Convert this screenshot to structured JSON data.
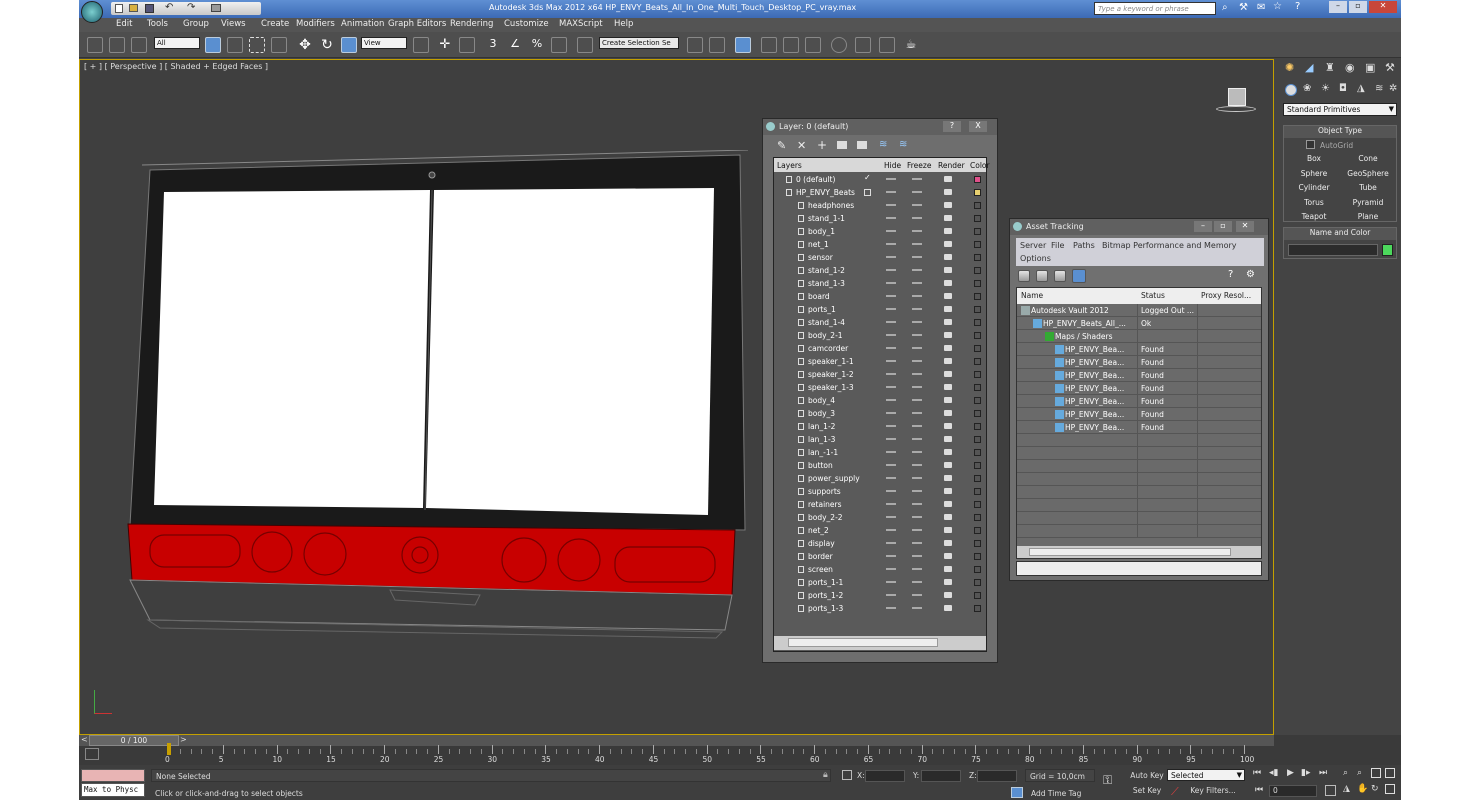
{
  "window": {
    "title": "Autodesk 3ds Max 2012 x64      HP_ENVY_Beats_All_In_One_Multi_Touch_Desktop_PC_vray.max",
    "search_placeholder": "Type a keyword or phrase"
  },
  "menu": [
    "Edit",
    "Tools",
    "Group",
    "Views",
    "Create",
    "Modifiers",
    "Animation",
    "Graph Editors",
    "Rendering",
    "Customize",
    "MAXScript",
    "Help"
  ],
  "toolbar": {
    "filter": "All",
    "view": "View",
    "selection_set": "Create Selection Se"
  },
  "viewport": {
    "label": "[ + ] [ Perspective ] [ Shaded + Edged Faces ]"
  },
  "layer_dialog": {
    "title": "Layer: 0 (default)",
    "help": "?",
    "close": "X",
    "columns": [
      "Layers",
      "Hide",
      "Freeze",
      "Render",
      "Color"
    ],
    "rows": [
      {
        "name": "0 (default)",
        "color": "#e0508a",
        "indent": 0,
        "active": true
      },
      {
        "name": "HP_ENVY_Beats",
        "color": "#e8d070",
        "indent": 0,
        "active": false
      },
      {
        "name": "headphones"
      },
      {
        "name": "stand_1-1"
      },
      {
        "name": "body_1"
      },
      {
        "name": "net_1"
      },
      {
        "name": "sensor"
      },
      {
        "name": "stand_1-2"
      },
      {
        "name": "stand_1-3"
      },
      {
        "name": "board"
      },
      {
        "name": "ports_1"
      },
      {
        "name": "stand_1-4"
      },
      {
        "name": "body_2-1"
      },
      {
        "name": "camcorder"
      },
      {
        "name": "speaker_1-1"
      },
      {
        "name": "speaker_1-2"
      },
      {
        "name": "speaker_1-3"
      },
      {
        "name": "body_4"
      },
      {
        "name": "body_3"
      },
      {
        "name": "lan_1-2"
      },
      {
        "name": "lan_1-3"
      },
      {
        "name": "lan_-1-1"
      },
      {
        "name": "button"
      },
      {
        "name": "power_supply"
      },
      {
        "name": "supports"
      },
      {
        "name": "retainers"
      },
      {
        "name": "body_2-2"
      },
      {
        "name": "net_2"
      },
      {
        "name": "display"
      },
      {
        "name": "border"
      },
      {
        "name": "screen"
      },
      {
        "name": "ports_1-1"
      },
      {
        "name": "ports_1-2"
      },
      {
        "name": "ports_1-3"
      }
    ]
  },
  "asset_tracking": {
    "title": "Asset Tracking",
    "menu": [
      "Server",
      "File",
      "Paths",
      "Bitmap Performance and Memory",
      "Options"
    ],
    "columns": [
      "Name",
      "Status",
      "Proxy Resol..."
    ],
    "rows": [
      {
        "name": "Autodesk Vault 2012",
        "status": "Logged Out ..."
      },
      {
        "name": "HP_ENVY_Beats_All_...",
        "status": "Ok"
      },
      {
        "name": "Maps / Shaders",
        "status": ""
      },
      {
        "name": "HP_ENVY_Bea...",
        "status": "Found"
      },
      {
        "name": "HP_ENVY_Bea...",
        "status": "Found"
      },
      {
        "name": "HP_ENVY_Bea...",
        "status": "Found"
      },
      {
        "name": "HP_ENVY_Bea...",
        "status": "Found"
      },
      {
        "name": "HP_ENVY_Bea...",
        "status": "Found"
      },
      {
        "name": "HP_ENVY_Bea...",
        "status": "Found"
      },
      {
        "name": "HP_ENVY_Bea...",
        "status": "Found"
      }
    ]
  },
  "command_panel": {
    "dropdown": "Standard Primitives",
    "object_type": "Object Type",
    "autogrid": "AutoGrid",
    "buttons": [
      "Box",
      "Cone",
      "Sphere",
      "GeoSphere",
      "Cylinder",
      "Tube",
      "Torus",
      "Pyramid",
      "Teapot",
      "Plane"
    ],
    "name_and_color": "Name and Color",
    "swatch_color": "#4cd85c"
  },
  "timeline": {
    "frame": "0 / 100",
    "ticks": [
      0,
      5,
      10,
      15,
      20,
      25,
      30,
      35,
      40,
      45,
      50,
      55,
      60,
      65,
      70,
      75,
      80,
      85,
      90,
      95,
      100
    ]
  },
  "status": {
    "listener": "Max to Physc",
    "selection": "None Selected",
    "prompt": "Click or click-and-drag to select objects",
    "x_label": "X:",
    "y_label": "Y:",
    "z_label": "Z:",
    "grid": "Grid = 10,0cm",
    "add_time_tag": "Add Time Tag",
    "auto_key": "Auto Key",
    "set_key": "Set Key",
    "selected": "Selected",
    "key_filters": "Key Filters...",
    "frame_value": "0"
  }
}
